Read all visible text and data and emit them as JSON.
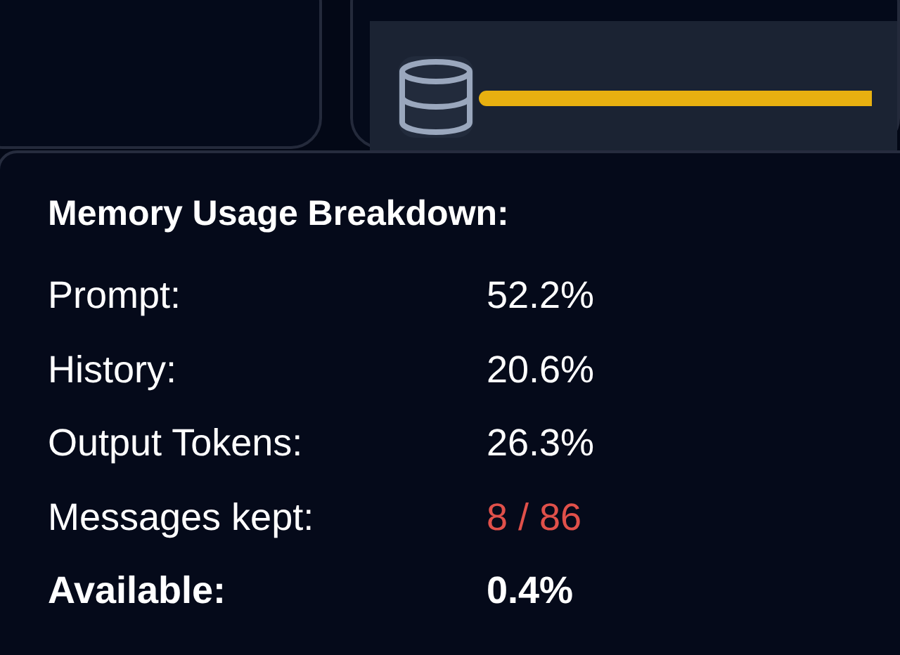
{
  "tooltip": {
    "title": "Memory Usage Breakdown:",
    "rows": [
      {
        "label": "Prompt:",
        "value": "52.2%",
        "kind": "normal"
      },
      {
        "label": "History:",
        "value": "20.6%",
        "kind": "normal"
      },
      {
        "label": "Output Tokens:",
        "value": "26.3%",
        "kind": "normal"
      },
      {
        "label": "Messages kept:",
        "value": "8 / 86",
        "kind": "warning"
      },
      {
        "label": "Available:",
        "value": "0.4%",
        "kind": "total"
      }
    ]
  }
}
